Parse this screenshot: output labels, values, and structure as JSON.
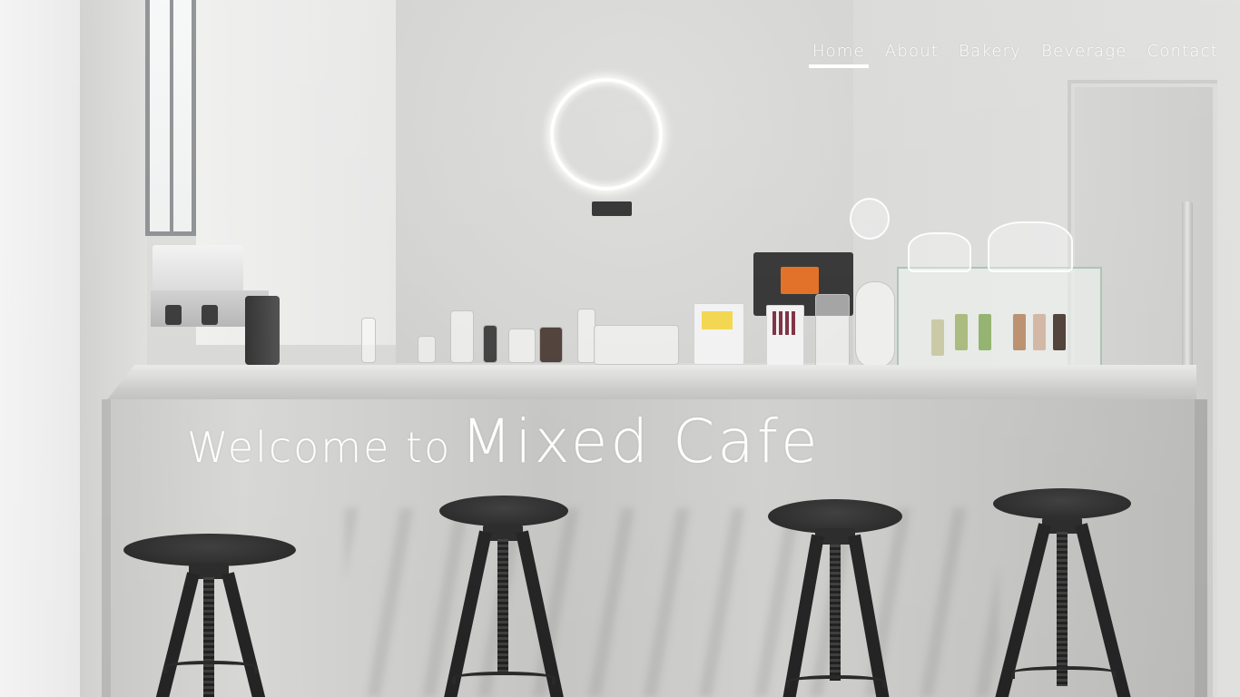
{
  "nav": {
    "items": [
      {
        "label": "Home",
        "active": true
      },
      {
        "label": "About",
        "active": false
      },
      {
        "label": "Bakery",
        "active": false
      },
      {
        "label": "Beverage",
        "active": false
      },
      {
        "label": "Contact",
        "active": false
      }
    ]
  },
  "hero": {
    "welcome_prefix": "Welcome to",
    "cafe_name": "Mixed Cafe"
  },
  "colors": {
    "nav_text": "#ffffff",
    "active_underline": "#ffffff",
    "neon": "#ffffff",
    "pos_accent": "#e06a1e"
  }
}
